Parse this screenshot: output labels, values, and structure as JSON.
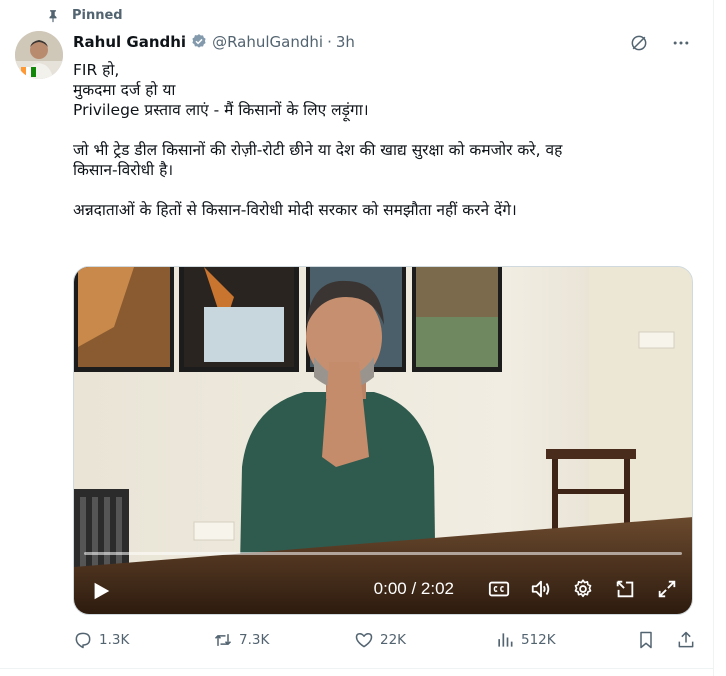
{
  "pinned_label": "Pinned",
  "author": {
    "name": "Rahul Gandhi",
    "handle": "@RahulGandhi",
    "separator": "·",
    "time": "3h",
    "verified_icon": "verified-badge-icon"
  },
  "body": {
    "lines": [
      "FIR हो,",
      "मुकदमा दर्ज हो या",
      "Privilege प्रस्ताव लाएं - मैं किसानों के लिए लड़ूंगा।",
      "",
      "जो भी ट्रेड डील किसानों की रोज़ी-रोटी छीने या देश की खाद्य सुरक्षा को कमजोर करे, वह",
      "किसान-विरोधी है।",
      "",
      "अन्नदाताओं के हितों से किसान-विरोधी मोदी सरकार को समझौता नहीं करने देंगे।"
    ]
  },
  "video": {
    "timecode": "0:00 / 2:02",
    "progress": 0.0
  },
  "actions": {
    "replies": "1.3K",
    "reposts": "7.3K",
    "likes": "22K",
    "views": "512K"
  },
  "colors": {
    "text": "#0f1419",
    "secondary": "#536471",
    "accent": "#1d9bf0"
  }
}
